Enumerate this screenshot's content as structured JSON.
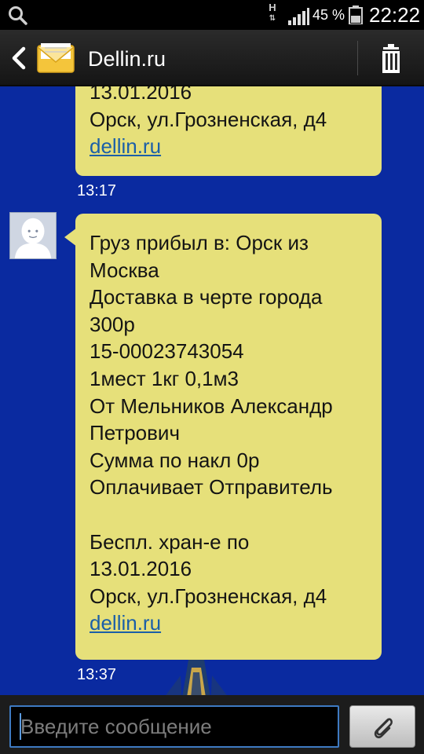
{
  "status_bar": {
    "network_type": "H",
    "battery_percent": "45 %",
    "time": "22:22"
  },
  "header": {
    "title": "Dellin.ru",
    "icons": [
      "back-icon",
      "envelope-icon",
      "trash-icon"
    ]
  },
  "messages": [
    {
      "lines": [
        "13.01.2016",
        "Орск, ул.Грозненская, д4"
      ],
      "link": "dellin.ru",
      "time": "13:17"
    },
    {
      "lines": [
        "Груз прибыл в: Орск из",
        "Москва",
        "Доставка в черте города",
        "300р",
        "15-00023743054",
        "1мест 1кг 0,1м3",
        "От Мельников Александр",
        "Петрович",
        "Сумма по накл 0р",
        "Оплачивает Отправитель",
        "",
        "Беспл. хран-е по",
        "13.01.2016",
        "Орск, ул.Грозненская, д4"
      ],
      "link": "dellin.ru",
      "time": "13:37"
    }
  ],
  "composer": {
    "placeholder": "Введите сообщение",
    "attach_icon": "paperclip-icon"
  },
  "colors": {
    "background": "#0a2aa0",
    "bubble": "#e6e07a",
    "link": "#1b5fa8",
    "input_border": "#3e7ac2"
  }
}
